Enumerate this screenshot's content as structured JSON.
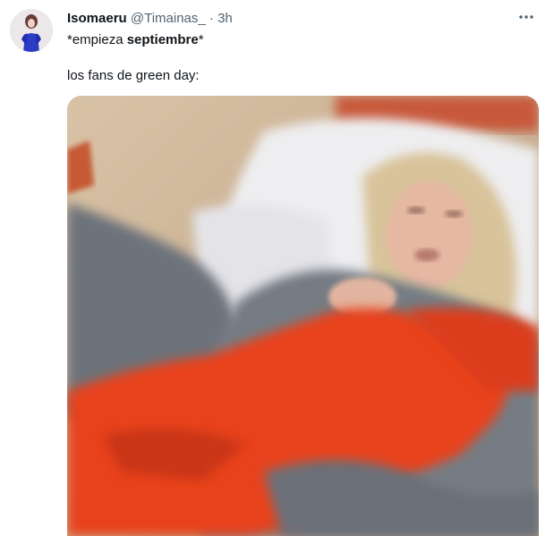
{
  "tweet": {
    "author_name": "Isomaeru",
    "handle": "@Timainas_",
    "separator": "·",
    "time": "3h",
    "more_icon": "more-horizontal-icon",
    "text_line1_prefix": "*empieza ",
    "text_line1_bold": "septiembre",
    "text_line1_suffix": "*",
    "text_line2": "los fans de green day:"
  },
  "colors": {
    "text": "#0f1419",
    "secondary": "#536471",
    "blanket": "#e8431e",
    "sheets": "#6e747c"
  },
  "media": {
    "type": "video-gif",
    "description_icon": "media-image"
  }
}
